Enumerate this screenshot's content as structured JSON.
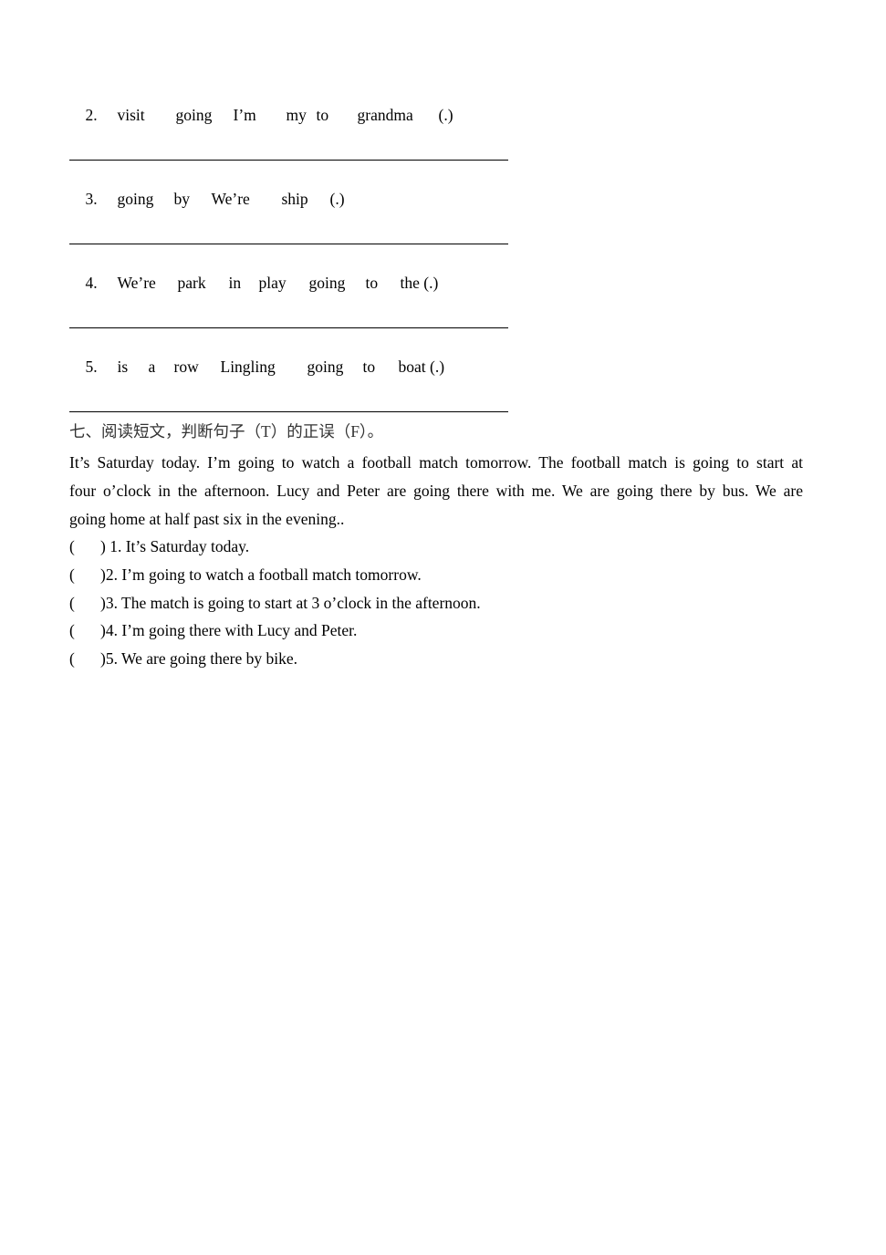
{
  "reorder_questions": [
    {
      "number": "2.",
      "words": [
        "visit",
        "going",
        "I’m",
        "my",
        "to",
        "grandma",
        "(.)"
      ]
    },
    {
      "number": "3.",
      "words": [
        "going",
        "by",
        "We’re",
        "ship",
        "(.)"
      ]
    },
    {
      "number": "4.",
      "words": [
        "We’re",
        "park",
        "in",
        "play",
        "going",
        "to",
        "the (.)"
      ]
    },
    {
      "number": "5.",
      "words": [
        "is",
        "a",
        "row",
        "Lingling",
        "going",
        "to",
        "boat (.)"
      ]
    }
  ],
  "section_seven": {
    "heading": "七、阅读短文，判断句子（T）的正误（F）。",
    "passage_lines": [
      "It’s Saturday today. I’m going to watch a football match tomorrow. The football match is going to start at",
      "four o’clock in the afternoon. Lucy and Peter are going there with me. We are going there by bus. We are",
      "going home at half past six in the evening.."
    ],
    "items": [
      {
        "paren_open": "(",
        "text": ") 1. It’s Saturday today."
      },
      {
        "paren_open": "(",
        "text": ")2. I’m going to watch a football match tomorrow."
      },
      {
        "paren_open": "(",
        "text": ")3. The match is going to start at 3 o’clock in the afternoon."
      },
      {
        "paren_open": "(",
        "text": ")4. I’m going there with Lucy and Peter."
      },
      {
        "paren_open": "(",
        "text": ")5. We are going there by bike."
      }
    ]
  }
}
